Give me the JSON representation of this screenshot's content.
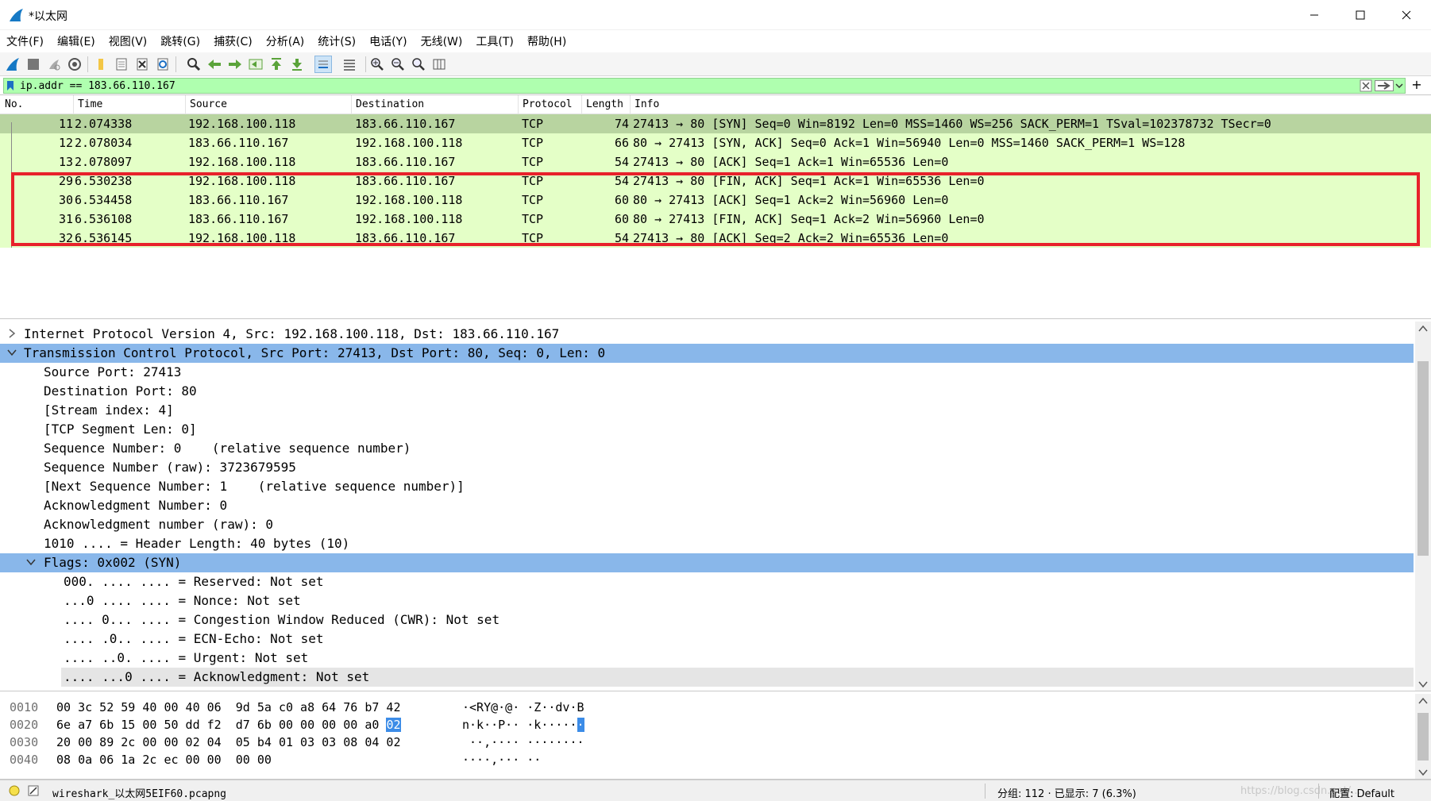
{
  "window": {
    "title": "*以太网"
  },
  "menu": [
    "文件(F)",
    "编辑(E)",
    "视图(V)",
    "跳转(G)",
    "捕获(C)",
    "分析(A)",
    "统计(S)",
    "电话(Y)",
    "无线(W)",
    "工具(T)",
    "帮助(H)"
  ],
  "filter": {
    "value": "ip.addr == 183.66.110.167"
  },
  "columns": {
    "no": "No.",
    "time": "Time",
    "source": "Source",
    "destination": "Destination",
    "protocol": "Protocol",
    "length": "Length",
    "info": "Info"
  },
  "packets": [
    {
      "no": "11",
      "time": "2.074338",
      "source": "192.168.100.118",
      "destination": "183.66.110.167",
      "protocol": "TCP",
      "length": "74",
      "info": "27413 → 80 [SYN] Seq=0 Win=8192 Len=0 MSS=1460 WS=256 SACK_PERM=1 TSval=102378732 TSecr=0"
    },
    {
      "no": "12",
      "time": "2.078034",
      "source": "183.66.110.167",
      "destination": "192.168.100.118",
      "protocol": "TCP",
      "length": "66",
      "info": "80 → 27413 [SYN, ACK] Seq=0 Ack=1 Win=56940 Len=0 MSS=1460 SACK_PERM=1 WS=128"
    },
    {
      "no": "13",
      "time": "2.078097",
      "source": "192.168.100.118",
      "destination": "183.66.110.167",
      "protocol": "TCP",
      "length": "54",
      "info": "27413 → 80 [ACK] Seq=1 Ack=1 Win=65536 Len=0"
    },
    {
      "no": "29",
      "time": "6.530238",
      "source": "192.168.100.118",
      "destination": "183.66.110.167",
      "protocol": "TCP",
      "length": "54",
      "info": "27413 → 80 [FIN, ACK] Seq=1 Ack=1 Win=65536 Len=0"
    },
    {
      "no": "30",
      "time": "6.534458",
      "source": "183.66.110.167",
      "destination": "192.168.100.118",
      "protocol": "TCP",
      "length": "60",
      "info": "80 → 27413 [ACK] Seq=1 Ack=2 Win=56960 Len=0"
    },
    {
      "no": "31",
      "time": "6.536108",
      "source": "183.66.110.167",
      "destination": "192.168.100.118",
      "protocol": "TCP",
      "length": "60",
      "info": "80 → 27413 [FIN, ACK] Seq=1 Ack=2 Win=56960 Len=0"
    },
    {
      "no": "32",
      "time": "6.536145",
      "source": "192.168.100.118",
      "destination": "183.66.110.167",
      "protocol": "TCP",
      "length": "54",
      "info": "27413 → 80 [ACK] Seq=2 Ack=2 Win=65536 Len=0"
    }
  ],
  "details": [
    "Internet Protocol Version 4, Src: 192.168.100.118, Dst: 183.66.110.167",
    "Transmission Control Protocol, Src Port: 27413, Dst Port: 80, Seq: 0, Len: 0",
    "Source Port: 27413",
    "Destination Port: 80",
    "[Stream index: 4]",
    "[TCP Segment Len: 0]",
    "Sequence Number: 0    (relative sequence number)",
    "Sequence Number (raw): 3723679595",
    "[Next Sequence Number: 1    (relative sequence number)]",
    "Acknowledgment Number: 0",
    "Acknowledgment number (raw): 0",
    "1010 .... = Header Length: 40 bytes (10)",
    "Flags: 0x002 (SYN)",
    "000. .... .... = Reserved: Not set",
    "...0 .... .... = Nonce: Not set",
    ".... 0... .... = Congestion Window Reduced (CWR): Not set",
    ".... .0.. .... = ECN-Echo: Not set",
    ".... ..0. .... = Urgent: Not set",
    ".... ...0 .... = Acknowledgment: Not set"
  ],
  "bytes": [
    {
      "offset": "0010",
      "hex_a": "00 3c 52 59 40 00 40 06",
      "hex_b": "9d 5a c0 a8 64 76 b7 42",
      "hex_b_hl": "",
      "ascii": "·<RY@·@·",
      "ascii_b": " ·Z··dv·B",
      "ascii_hl": ""
    },
    {
      "offset": "0020",
      "hex_a": "6e a7 6b 15 00 50 dd f2",
      "hex_b": "d7 6b 00 00 00 00 a0 ",
      "hex_b_hl": "02",
      "ascii": "n·k··P··",
      "ascii_b": " ·k·····",
      "ascii_hl": "·"
    },
    {
      "offset": "0030",
      "hex_a": "20 00 89 2c 00 00 02 04",
      "hex_b": "05 b4 01 03 03 08 04 02",
      "hex_b_hl": "",
      "ascii": " ··,····",
      "ascii_b": " ········",
      "ascii_hl": ""
    },
    {
      "offset": "0040",
      "hex_a": "08 0a 06 1a 2c ec 00 00",
      "hex_b": "00 00",
      "hex_b_hl": "",
      "ascii": "····,···",
      "ascii_b": " ··",
      "ascii_hl": ""
    }
  ],
  "status": {
    "file": "wireshark_以太网5EIF60.pcapng",
    "packets": "分组: 112 · 已显示: 7 (6.3%)",
    "profile": "配置: Default",
    "watermark": "https://blog.csdn.net/..."
  },
  "colors": {
    "row_bg": "#e4ffc7",
    "selected_row": "#b8d4a0",
    "filter_bg": "#afffaf",
    "detail_select": "#89b7ea",
    "highlight_border": "#e8212b"
  }
}
